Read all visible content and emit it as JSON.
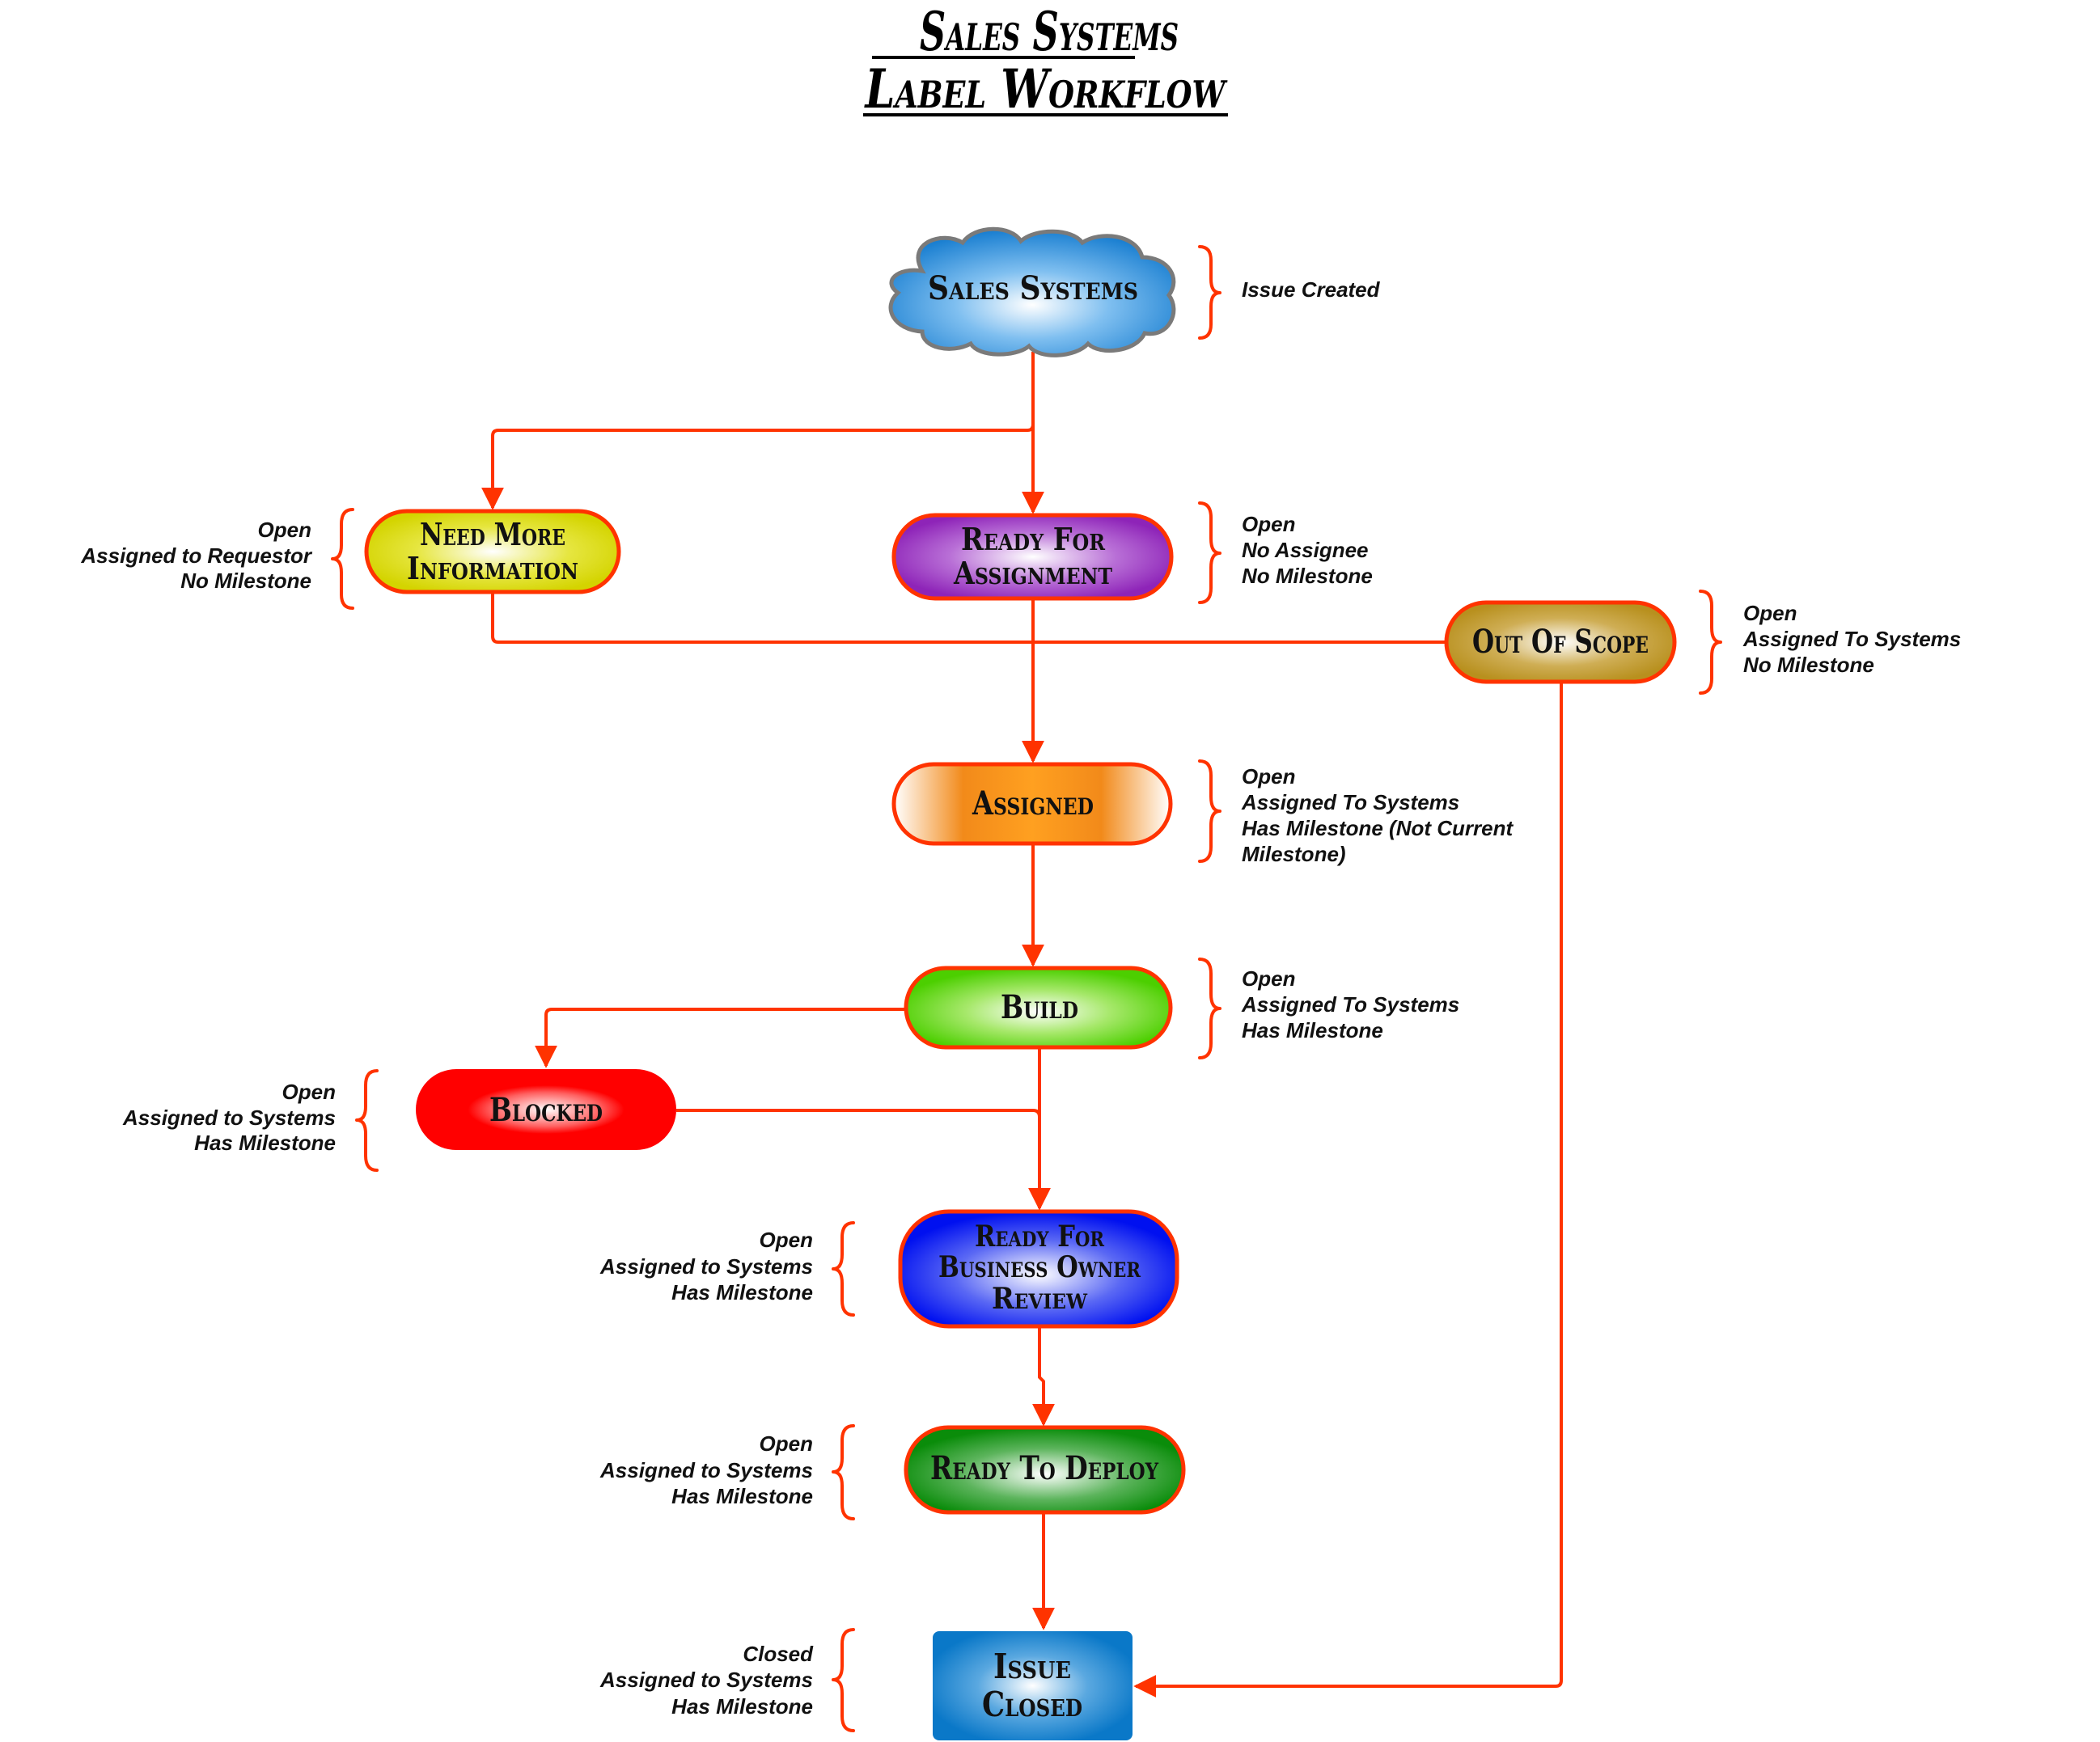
{
  "title": {
    "line1": "Sales Systems",
    "line2": "Label Workflow"
  },
  "colors": {
    "connector": "#ff3300",
    "brace": "#ff3300",
    "cloud": "#1a7fd1",
    "need_more_information": "#d4d400",
    "ready_for_assignment": "#8e24b8",
    "out_of_scope": "#b8901e",
    "assigned": "#f07a00",
    "build": "#4ccf00",
    "blocked": "#ff0000",
    "ready_for_business_owner_review": "#0010f0",
    "ready_to_deploy": "#0a8c0a",
    "issue_closed": "#0a78c8"
  },
  "nodes": {
    "sales_systems": {
      "label": "Sales Systems",
      "shape": "cloud",
      "annotation": [
        "Issue Created"
      ]
    },
    "need_more_information": {
      "lines": [
        "Need More",
        "Information"
      ],
      "annotation": [
        "Open",
        "Assigned to Requestor",
        "No Milestone"
      ]
    },
    "ready_for_assignment": {
      "lines": [
        "Ready For",
        "Assignment"
      ],
      "annotation": [
        "Open",
        "No Assignee",
        "No Milestone"
      ]
    },
    "out_of_scope": {
      "lines": [
        "Out Of Scope"
      ],
      "annotation": [
        "Open",
        "Assigned To Systems",
        "No Milestone"
      ]
    },
    "assigned": {
      "lines": [
        "Assigned"
      ],
      "annotation": [
        "Open",
        "Assigned To Systems",
        "Has Milestone (Not Current",
        "Milestone)"
      ]
    },
    "build": {
      "lines": [
        "Build"
      ],
      "annotation": [
        "Open",
        "Assigned To Systems",
        "Has Milestone"
      ]
    },
    "blocked": {
      "lines": [
        "Blocked"
      ],
      "annotation": [
        "Open",
        "Assigned to Systems",
        "Has Milestone"
      ]
    },
    "ready_for_business_owner_review": {
      "lines": [
        "Ready For",
        "Business Owner",
        "Review"
      ],
      "annotation": [
        "Open",
        "Assigned to Systems",
        "Has Milestone"
      ]
    },
    "ready_to_deploy": {
      "lines": [
        "Ready To Deploy"
      ],
      "annotation": [
        "Open",
        "Assigned to Systems",
        "Has Milestone"
      ]
    },
    "issue_closed": {
      "lines": [
        "Issue",
        "Closed"
      ],
      "annotation": [
        "Closed",
        "Assigned to Systems",
        "Has Milestone"
      ]
    }
  },
  "edges": [
    {
      "from": "sales_systems",
      "to": "ready_for_assignment"
    },
    {
      "from": "sales_systems",
      "to": "need_more_information"
    },
    {
      "from": "need_more_information",
      "to": "out_of_scope",
      "arrow": false
    },
    {
      "from": "ready_for_assignment",
      "to": "assigned"
    },
    {
      "from": "assigned",
      "to": "build"
    },
    {
      "from": "build",
      "to": "blocked"
    },
    {
      "from": "build",
      "to": "ready_for_business_owner_review"
    },
    {
      "from": "blocked",
      "to": "ready_for_business_owner_review"
    },
    {
      "from": "ready_for_business_owner_review",
      "to": "ready_to_deploy"
    },
    {
      "from": "ready_to_deploy",
      "to": "issue_closed"
    },
    {
      "from": "out_of_scope",
      "to": "issue_closed"
    }
  ]
}
